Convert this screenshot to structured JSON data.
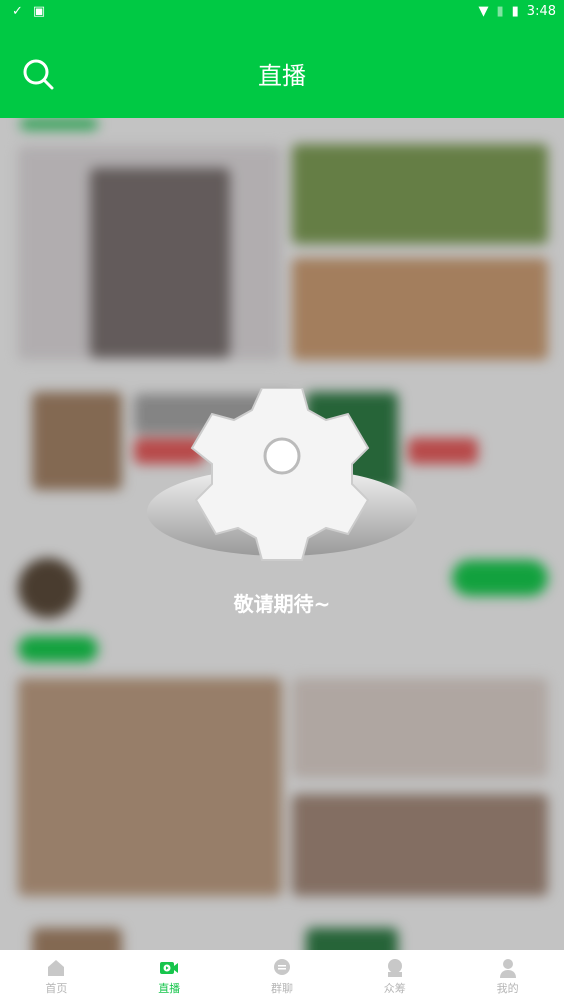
{
  "status_bar": {
    "time": "3:48",
    "icons": [
      "download-done-icon",
      "a-icon",
      "wifi-icon",
      "no-sim-icon",
      "battery-charging-icon"
    ]
  },
  "header": {
    "title": "直播",
    "search_icon": "search-icon"
  },
  "overlay": {
    "message": "敬请期待~",
    "icon": "gear-icon"
  },
  "tabbar": {
    "items": [
      {
        "label": "首页",
        "icon": "home-icon",
        "active": false
      },
      {
        "label": "直播",
        "icon": "live-video-icon",
        "active": true
      },
      {
        "label": "群聊",
        "icon": "chat-icon",
        "active": false
      },
      {
        "label": "众筹",
        "icon": "crowdfund-icon",
        "active": false
      },
      {
        "label": "我的",
        "icon": "user-icon",
        "active": false
      }
    ]
  },
  "colors": {
    "brand": "#00c944",
    "active_tab": "#17c54c",
    "inactive_tab": "#b5b5b5"
  }
}
